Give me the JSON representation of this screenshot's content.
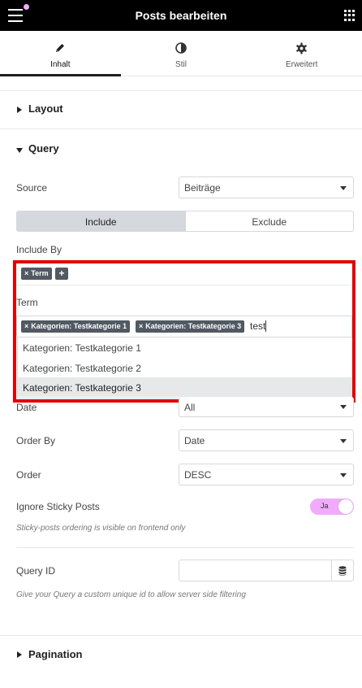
{
  "header": {
    "title": "Posts bearbeiten"
  },
  "tabs": [
    {
      "label": "Inhalt",
      "icon": "pencil-icon",
      "active": true
    },
    {
      "label": "Stil",
      "icon": "half-circle-icon",
      "active": false
    },
    {
      "label": "Erweitert",
      "icon": "gear-icon",
      "active": false
    }
  ],
  "sections": {
    "layout": "Layout",
    "query": "Query",
    "pagination": "Pagination"
  },
  "query": {
    "source_label": "Source",
    "source_value": "Beiträge",
    "switch_include": "Include",
    "switch_exclude": "Exclude",
    "include_by_label": "Include By",
    "include_by_chip": "Term",
    "term_label": "Term",
    "term_chips": [
      "Kategorien: Testkategorie 1",
      "Kategorien: Testkategorie 3"
    ],
    "term_search": "test",
    "dropdown_options": [
      "Kategorien: Testkategorie 1",
      "Kategorien: Testkategorie 2",
      "Kategorien: Testkategorie 3"
    ],
    "date_label": "Date",
    "date_value": "All",
    "order_by_label": "Order By",
    "order_by_value": "Date",
    "order_label": "Order",
    "order_value": "DESC",
    "sticky_label": "Ignore Sticky Posts",
    "sticky_toggle": "Ja",
    "sticky_desc": "Sticky-posts ordering is visible on frontend only",
    "query_id_label": "Query ID",
    "query_id_value": "",
    "query_id_desc": "Give your Query a custom unique id to allow server side filtering"
  },
  "colors": {
    "accent_pink": "#f0abfc",
    "highlight_red": "#e00000",
    "chip_gray": "#515962"
  }
}
